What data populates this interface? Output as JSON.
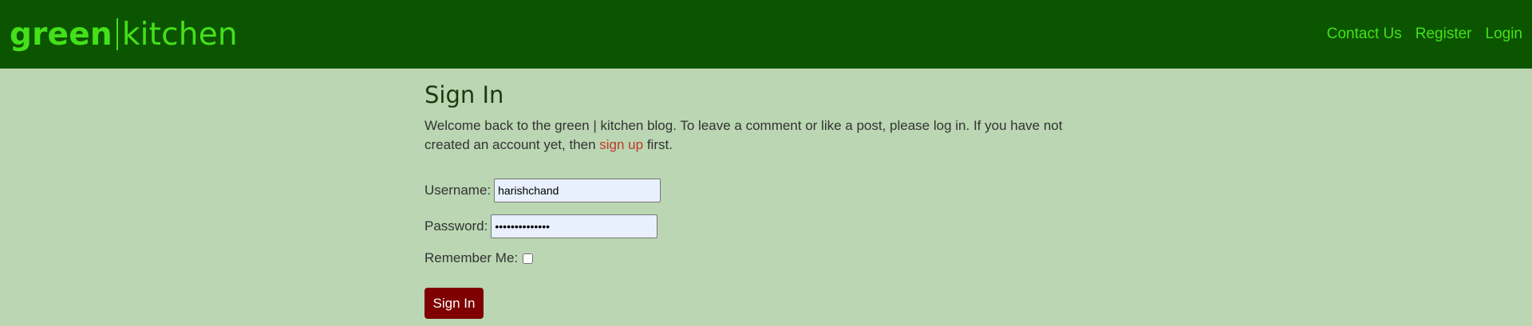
{
  "brand": {
    "part1": "green",
    "part2": "kitchen"
  },
  "nav": {
    "contact": "Contact Us",
    "register": "Register",
    "login": "Login"
  },
  "page": {
    "title": "Sign In",
    "intro_before": "Welcome back to the green | kitchen blog. To leave a comment or like a post, please log in. If you have not created an account yet, then ",
    "signup_link": "sign up",
    "intro_after": " first."
  },
  "form": {
    "username_label": "Username:",
    "username_value": "harishchand",
    "password_label": "Password:",
    "password_value": "••••••••••••••",
    "remember_label": "Remember Me:",
    "remember_checked": false,
    "submit_label": "Sign In"
  },
  "colors": {
    "navbar": "#0c5500",
    "brand": "#44e01a",
    "background": "#bad6b2",
    "button": "#7e0000",
    "link": "#c0392b"
  }
}
